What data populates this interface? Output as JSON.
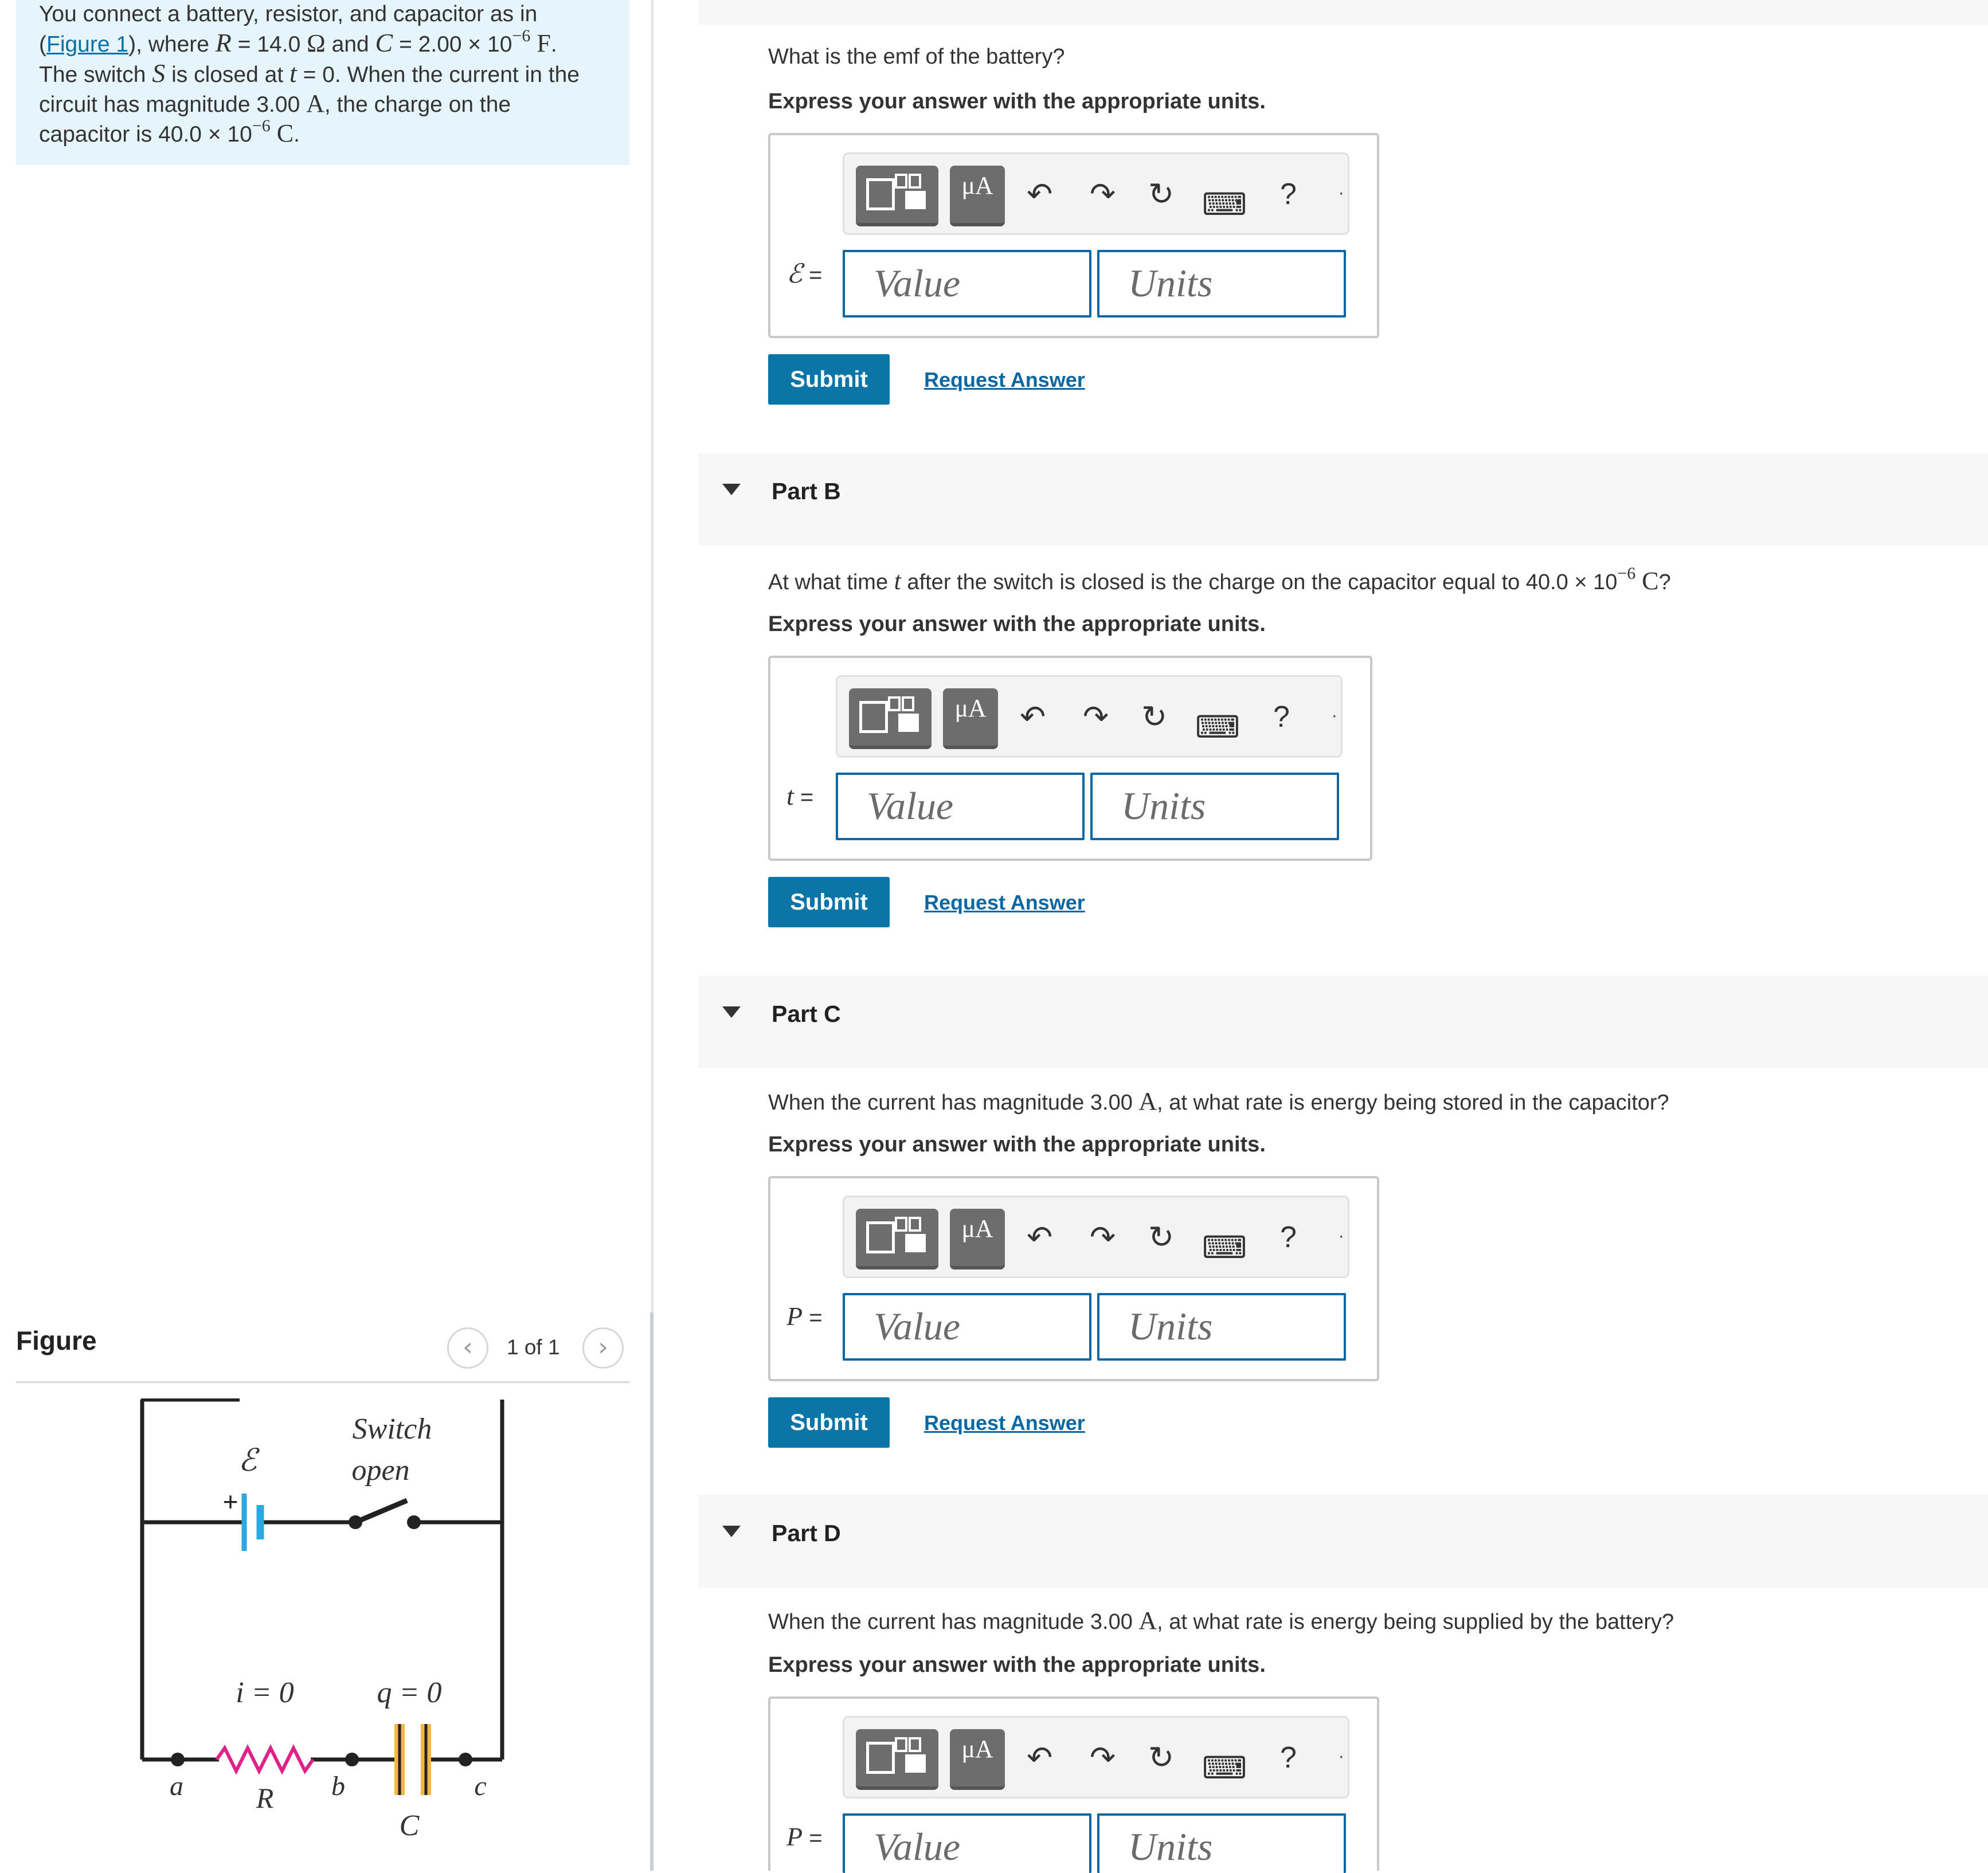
{
  "problem": {
    "t1": "You connect a battery, resistor, and capacitor as in",
    "open_paren": "(",
    "figure_link": "Figure 1",
    "t2": "), where ",
    "R_sym": "R",
    "t3": " = 14.0 ",
    "ohm": "Ω",
    "t4": " and ",
    "C_sym": "C",
    "t5": " = 2.00 × 10",
    "exp1": "−6",
    "F_unit": " F",
    "period1": ".",
    "t6": "The switch ",
    "S_sym": "S",
    "t7": " is closed at ",
    "t_sym": "t",
    "t8": " = 0. When the current in the",
    "t9": "circuit has magnitude 3.00 ",
    "A_unit": "A",
    "t10": ", the charge on the",
    "t11": "capacitor is 40.0 × 10",
    "exp2": "−6",
    "C_unit": " C",
    "period2": "."
  },
  "figure": {
    "title": "Figure",
    "page": "1 of 1",
    "prev_glyph": "‹",
    "next_glyph": "›",
    "labels": {
      "emf": "ℰ",
      "plus": "+",
      "switch": "Switch",
      "open": "open",
      "i": "i = 0",
      "q": "q = 0",
      "a": "a",
      "R": "R",
      "b": "b",
      "C": "C",
      "c": "c"
    }
  },
  "toolbar": {
    "mu": "μA",
    "undo": "↶",
    "redo": "↷",
    "reset": "↻",
    "keyboard": "⌨",
    "help": "?",
    "more": "·"
  },
  "parts": [
    {
      "question": "What is the emf of the battery?",
      "instruction": "Express your answer with the appropriate units.",
      "var": "ℰ",
      "eq": " =",
      "value_placeholder": "Value",
      "units_placeholder": "Units",
      "submit": "Submit",
      "request": "Request Answer"
    },
    {
      "title": "Part B",
      "q_pre": "At what time ",
      "q_var": "t",
      "q_mid": " after the switch is closed is the charge on the capacitor equal to 40.0 × 10",
      "q_exp": "−6",
      "q_unit": " C",
      "q_end": "?",
      "instruction": "Express your answer with the appropriate units.",
      "var": "t",
      "eq": " =",
      "value_placeholder": "Value",
      "units_placeholder": "Units",
      "submit": "Submit",
      "request": "Request Answer"
    },
    {
      "title": "Part C",
      "q_pre": "When the current has magnitude 3.00 ",
      "q_unit": "A",
      "q_end": ", at what rate is energy being stored in the capacitor?",
      "instruction": "Express your answer with the appropriate units.",
      "var": "P",
      "eq": " =",
      "value_placeholder": "Value",
      "units_placeholder": "Units",
      "submit": "Submit",
      "request": "Request Answer"
    },
    {
      "title": "Part D",
      "q_pre": "When the current has magnitude 3.00 ",
      "q_unit": "A",
      "q_end": ", at what rate is energy being supplied by the battery?",
      "instruction": "Express your answer with the appropriate units.",
      "var": "P",
      "eq": " =",
      "value_placeholder": "Value",
      "units_placeholder": "Units"
    }
  ],
  "colors": {
    "problem_bg": "#e6f5fb",
    "accent": "#0b75a8",
    "field_border": "#0b67a3",
    "battery": "#29a9e0",
    "resistor": "#e0218a",
    "capacitor": "#f5b642"
  }
}
